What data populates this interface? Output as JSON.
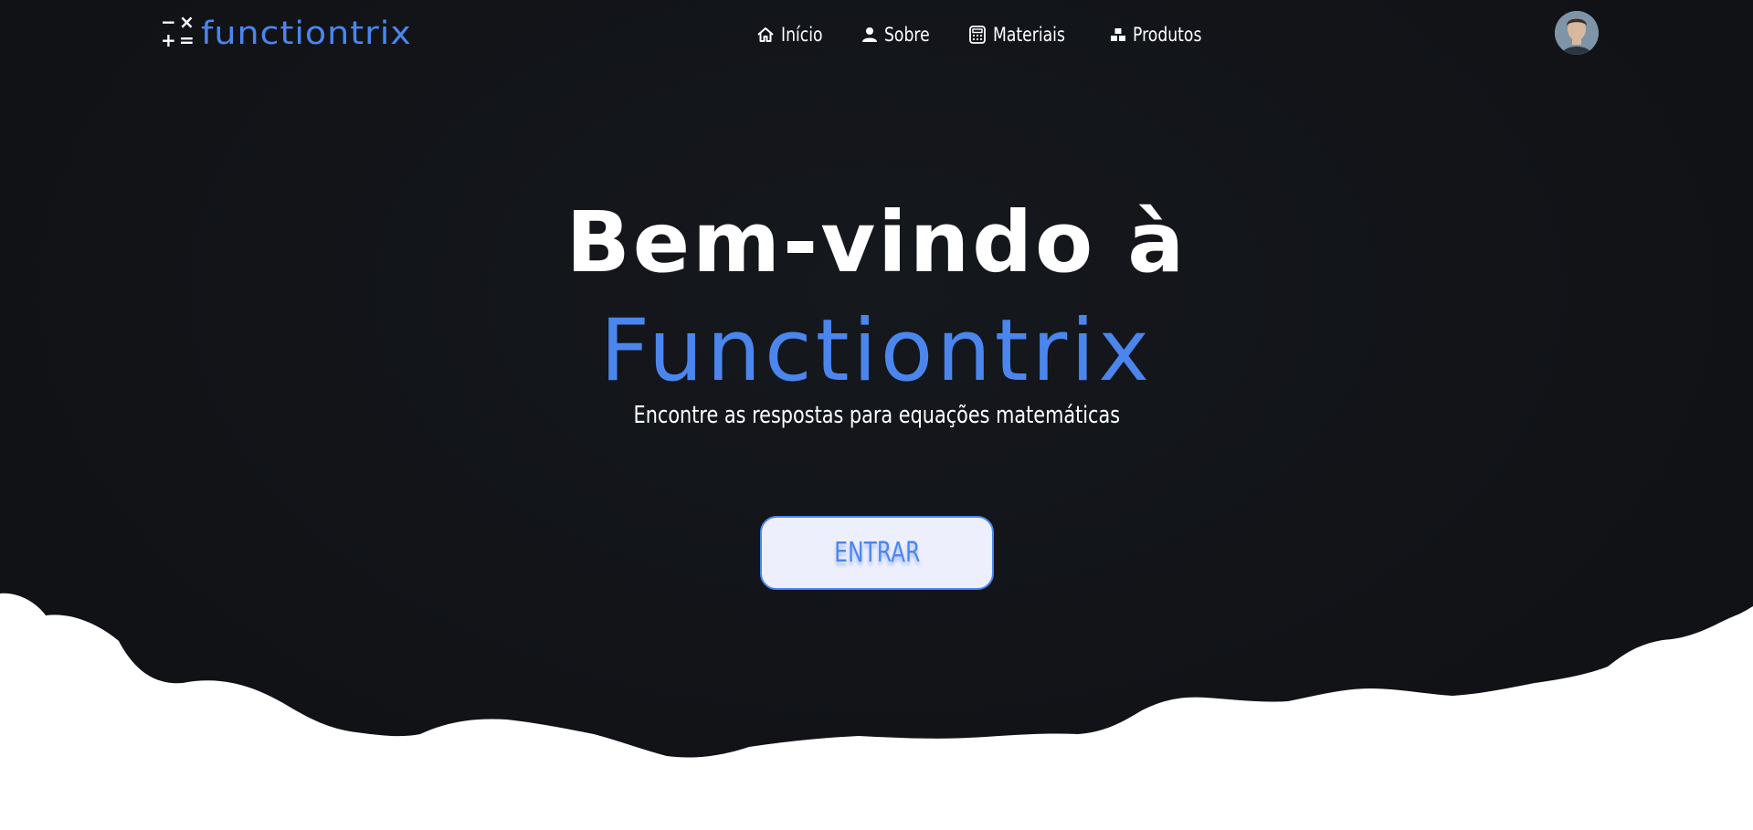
{
  "brand": {
    "name": "functiontrix",
    "icon": "calculator-symbols-icon",
    "accent_color": "#4b86ee"
  },
  "nav": {
    "items": [
      {
        "label": "Início",
        "icon": "home-icon"
      },
      {
        "label": "Sobre",
        "icon": "user-icon"
      },
      {
        "label": "Materiais",
        "icon": "calculator-icon"
      },
      {
        "label": "Produtos",
        "icon": "boxes-icon"
      }
    ]
  },
  "user": {
    "avatar_icon": "profile-avatar"
  },
  "hero": {
    "title_line1": "Bem-vindo à",
    "title_line2": "Functiontrix",
    "subtitle": "Encontre as respostas para equações matemáticas",
    "cta_label": "ENTRAR"
  },
  "colors": {
    "background": "#111317",
    "text": "#ffffff",
    "accent": "#4b86ee",
    "button_bg": "#eeeffc",
    "clouds": "#ffffff"
  }
}
